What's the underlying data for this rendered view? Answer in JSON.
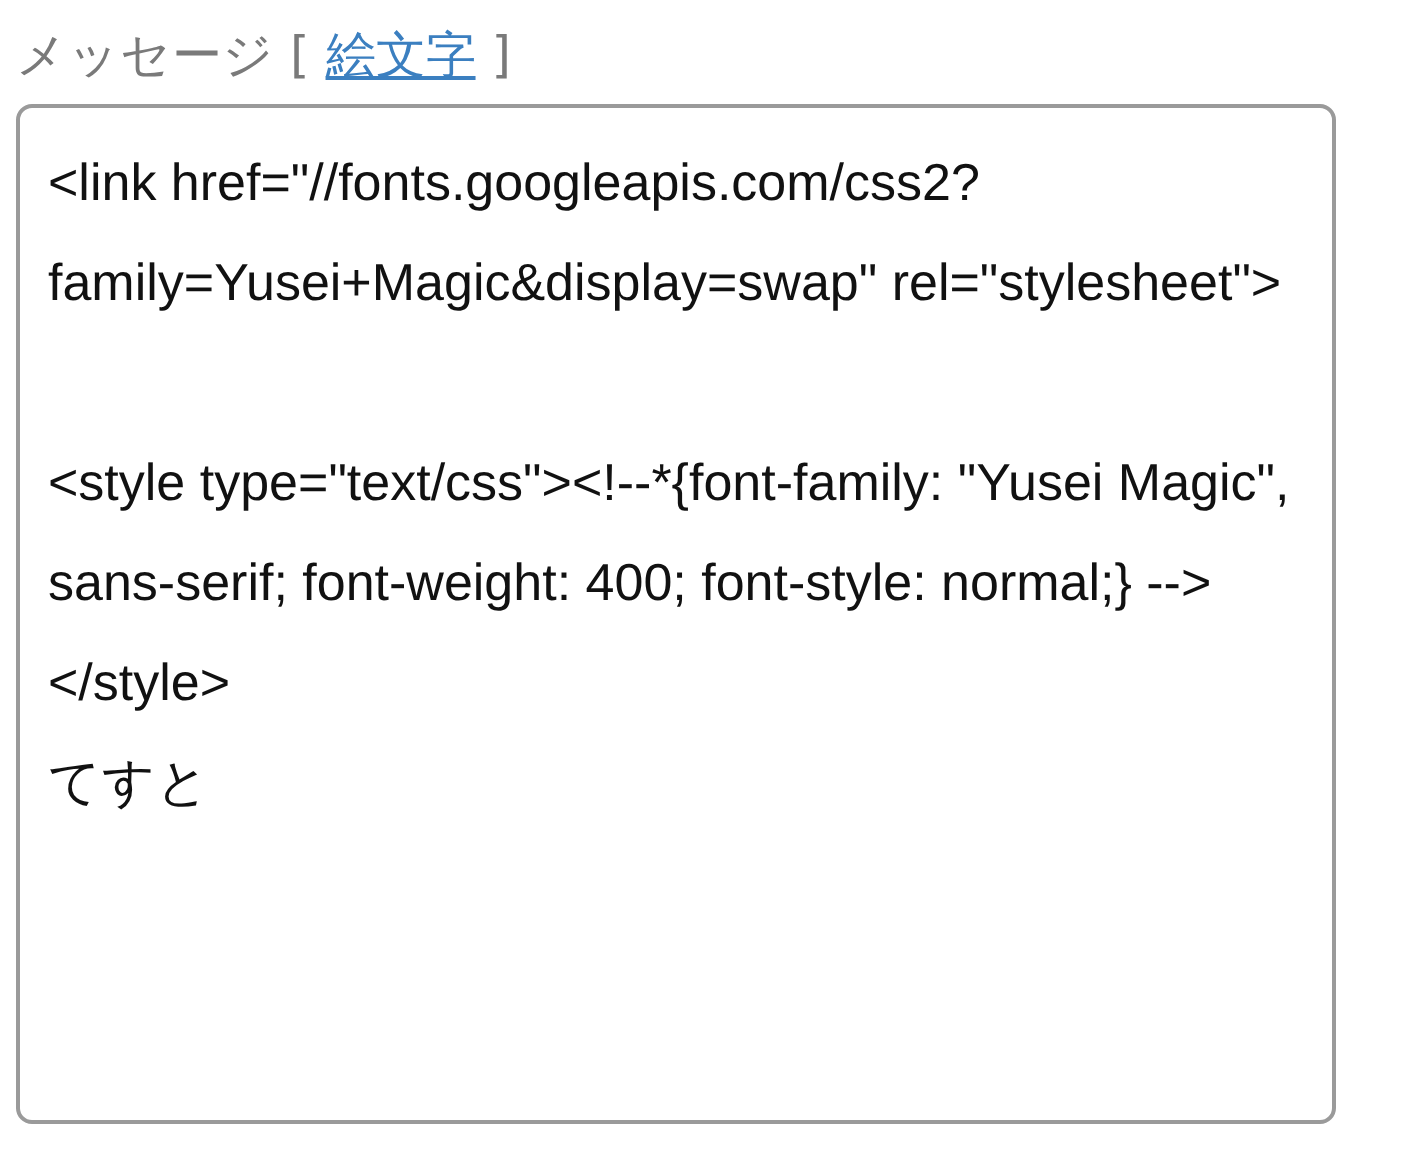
{
  "message": {
    "label": "メッセージ",
    "open_bracket": "[",
    "emoji_link": "絵文字",
    "close_bracket": "]",
    "value": "<link href=\"//fonts.googleapis.com/css2?family=Yusei+Magic&display=swap\" rel=\"stylesheet\">\n\n<style type=\"text/css\"><!--*{font-family: \"Yusei Magic\", sans-serif; font-weight: 400; font-style: normal;} --></style>\nてすと"
  }
}
